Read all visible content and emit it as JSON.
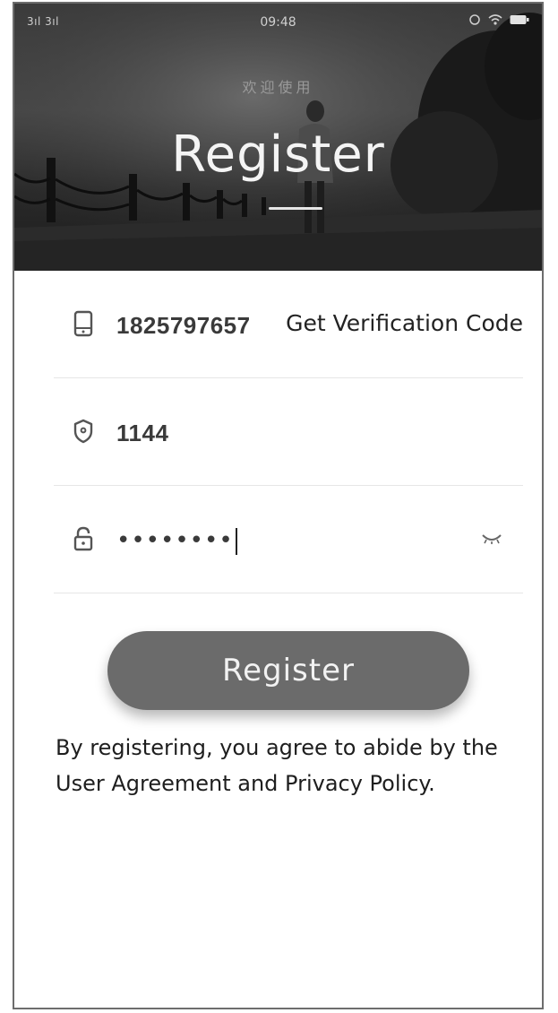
{
  "status_bar": {
    "signal": "3ıl 3ıl",
    "time": "09:48"
  },
  "header": {
    "welcome": "欢迎使用",
    "title": "Register"
  },
  "form": {
    "phone": {
      "icon": "phone-icon",
      "value": "1825797657",
      "get_code_label": "Get Verification Code"
    },
    "code": {
      "icon": "shield-icon",
      "value": "1144"
    },
    "password": {
      "icon": "lock-icon",
      "masked_value": "••••••••",
      "toggle_icon": "eye-closed-icon"
    }
  },
  "register_button": {
    "label": "Register"
  },
  "agreement": {
    "text": "By registering, you agree to abide by the User Agreement and Privacy Policy."
  },
  "colors": {
    "button": "#6b6b6b",
    "text": "#1e1e1e",
    "divider": "#e6e6e6"
  }
}
